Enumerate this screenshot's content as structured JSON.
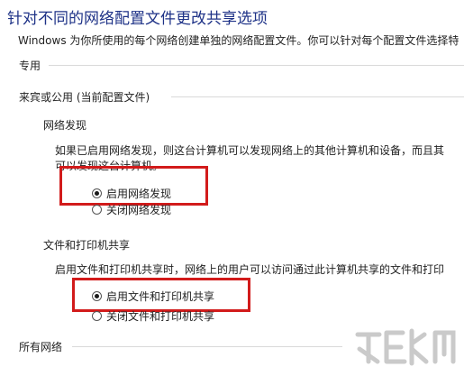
{
  "page": {
    "title": "针对不同的网络配置文件更改共享选项",
    "description": "Windows 为你所使用的每个网络创建单独的网络配置文件。你可以针对每个配置文件选择特"
  },
  "sections": {
    "private": "专用",
    "guest_public": "来宾或公用 (当前配置文件)",
    "all_networks": "所有网络"
  },
  "network_discovery": {
    "heading": "网络发现",
    "text_line1": "如果已启用网络发现，则这台计算机可以发现网络上的其他计算机和设备，而且其",
    "text_line2": "可以发现这台计算机。",
    "option_on": "启用网络发现",
    "option_off": "关闭网络发现",
    "selected": "on"
  },
  "file_printer_sharing": {
    "heading": "文件和打印机共享",
    "text": "启用文件和打印机共享时，网络上的用户可以访问通过此计算机共享的文件和打印",
    "option_on": "启用文件和打印机共享",
    "option_off": "关闭文件和打印机共享",
    "selected": "on"
  },
  "colors": {
    "title": "#1e3287",
    "highlight_box": "#d21b1b"
  }
}
